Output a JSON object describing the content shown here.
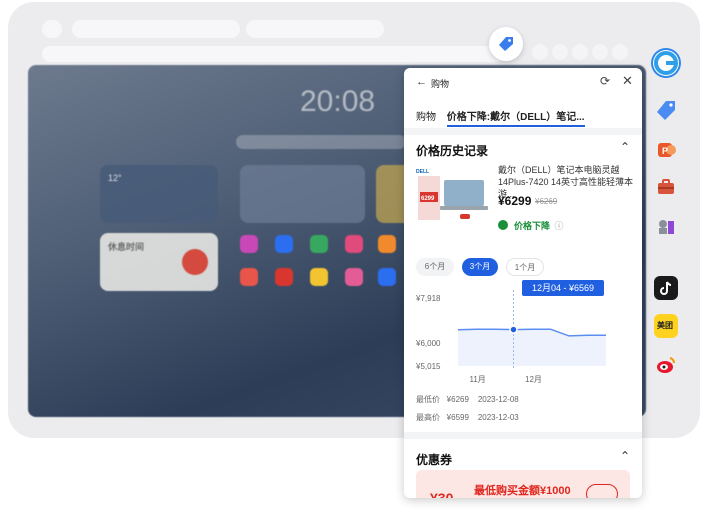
{
  "desktop": {
    "clock": "20:08",
    "weather_temp": "12°",
    "rest_card_title": "休息时间"
  },
  "panel": {
    "header": {
      "back_label": "购物"
    },
    "tabs": [
      {
        "label": "购物"
      },
      {
        "label": "价格下降:戴尔（DELL）笔记..."
      }
    ],
    "history_section": {
      "title": "价格历史记录",
      "product": {
        "title": "戴尔（DELL）笔记本电脑灵越14Plus-7420 14英寸高性能轻薄本游...",
        "price": "¥6299",
        "original_price": "¥6269",
        "badge": "价格下降",
        "image_price": "6299"
      },
      "ranges": [
        "6个月",
        "3个月",
        "1个月"
      ],
      "selected_range": "3个月",
      "tooltip": "12月04 - ¥6569",
      "colors": {
        "accent": "#1f5fe0",
        "drop_green": "#1a8f3a"
      }
    },
    "stats": {
      "lowest_label": "最低价",
      "lowest_price": "¥6269",
      "lowest_date": "2023-12-08",
      "highest_label": "最高价",
      "highest_price": "¥6599",
      "highest_date": "2023-12-03"
    },
    "coupon_section": {
      "title": "优惠券",
      "coupon_text": "最低购买金额¥1000",
      "coupon_amount": "¥30"
    }
  },
  "chart_data": {
    "type": "line",
    "x": [
      "11月",
      "",
      "12月",
      "",
      "",
      "",
      "",
      ""
    ],
    "xlabels": [
      "11月",
      "12月"
    ],
    "yticks": [
      "¥7,918",
      "¥6,000",
      "¥5,015"
    ],
    "ylim": [
      5015,
      7918
    ],
    "series": [
      {
        "values": [
          6560,
          6585,
          6585,
          6569,
          6585,
          6585,
          6300,
          6330,
          6330
        ]
      }
    ],
    "highlight_index": 3,
    "grid": false
  }
}
